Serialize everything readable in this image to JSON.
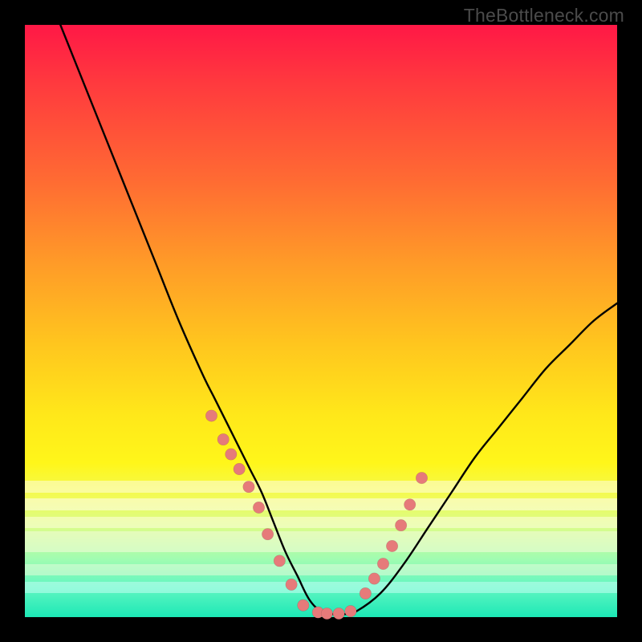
{
  "watermark": "TheBottleneck.com",
  "colors": {
    "background": "#000000",
    "gradient_top": "#ff1846",
    "gradient_bottom": "#1ce8b6",
    "curve": "#000000",
    "dots": "#e67a7a"
  },
  "chart_data": {
    "type": "line",
    "title": "",
    "xlabel": "",
    "ylabel": "",
    "xlim": [
      0,
      100
    ],
    "ylim": [
      0,
      100
    ],
    "note": "Axes are unlabeled; values are pixel-proportional estimates in 0–100 space. Lower y = closer to bottom (green, optimal).",
    "series": [
      {
        "name": "bottleneck-curve",
        "x": [
          6,
          10,
          14,
          18,
          22,
          26,
          30,
          32,
          34,
          36,
          38,
          40,
          42,
          44,
          46,
          48,
          50,
          52,
          54,
          56,
          60,
          64,
          68,
          72,
          76,
          80,
          84,
          88,
          92,
          96,
          100
        ],
        "y": [
          100,
          90,
          80,
          70,
          60,
          50,
          41,
          37,
          33,
          29,
          25,
          21,
          16,
          11,
          7,
          3,
          1,
          0.5,
          0.5,
          1,
          4,
          9,
          15,
          21,
          27,
          32,
          37,
          42,
          46,
          50,
          53
        ]
      }
    ],
    "scatter": [
      {
        "name": "marker-dots-left",
        "x": [
          31.5,
          33.5,
          34.8,
          36.2,
          37.8,
          39.5,
          41.0,
          43.0,
          45.0
        ],
        "y": [
          34.0,
          30.0,
          27.5,
          25.0,
          22.0,
          18.5,
          14.0,
          9.5,
          5.5
        ]
      },
      {
        "name": "marker-dots-bottom",
        "x": [
          47.0,
          49.5,
          51.0,
          53.0,
          55.0
        ],
        "y": [
          2.0,
          0.8,
          0.6,
          0.6,
          1.0
        ]
      },
      {
        "name": "marker-dots-right",
        "x": [
          57.5,
          59.0,
          60.5,
          62.0,
          63.5,
          65.0,
          67.0
        ],
        "y": [
          4.0,
          6.5,
          9.0,
          12.0,
          15.5,
          19.0,
          23.5
        ]
      }
    ],
    "bottom_bands": [
      {
        "y": 21.0,
        "h": 2.0,
        "color": "#fffde0"
      },
      {
        "y": 18.0,
        "h": 2.0,
        "color": "#fffef0"
      },
      {
        "y": 11.0,
        "h": 3.5,
        "color": "#f6fbdc"
      },
      {
        "y": 15.0,
        "h": 2.0,
        "color": "#fffde0"
      },
      {
        "y": 7.0,
        "h": 2.0,
        "color": "#e2fbd8"
      },
      {
        "y": 4.0,
        "h": 2.0,
        "color": "#c2fff2"
      }
    ]
  }
}
